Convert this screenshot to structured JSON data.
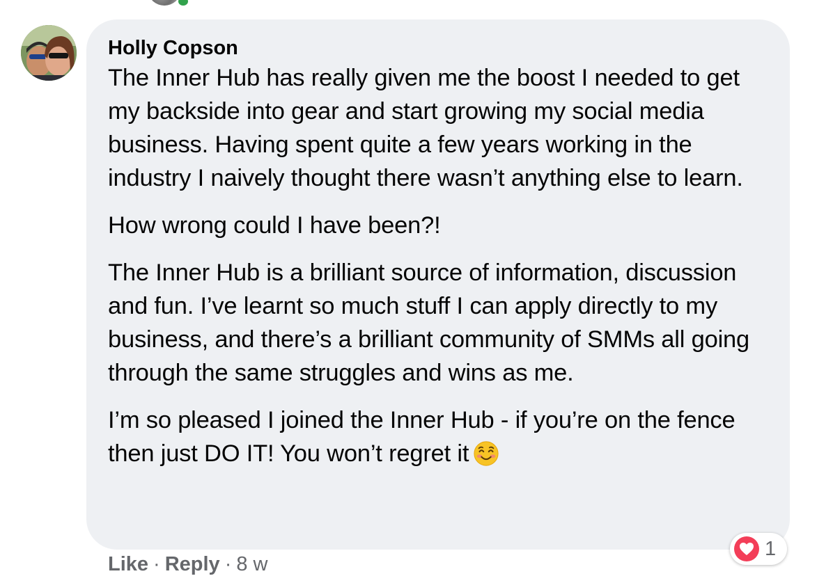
{
  "comment": {
    "author": "Holly Copson",
    "paragraphs": [
      "The Inner Hub has really given me the boost I needed to get my backside into gear and start growing my social media business. Having spent quite a few years working in the industry I naively thought there wasn’t anything else to learn.",
      "How wrong could I have been?!",
      "The Inner Hub is a brilliant source of information, discussion and fun. I’ve learnt so much stuff I can apply directly to my business, and there’s a brilliant community of SMMs all going through the same struggles and wins as me.",
      "I’m so pleased I joined the Inner Hub - if you’re on the fence then just DO IT! You won’t regret it"
    ],
    "emoji": "smiling-face-with-smiling-eyes"
  },
  "actions": {
    "like_label": "Like",
    "separator": "·",
    "reply_label": "Reply",
    "timestamp": "8 w"
  },
  "reactions": {
    "type": "love",
    "icon": "heart-icon",
    "count": "1",
    "badge_color": "#f33e58"
  },
  "colors": {
    "bubble": "#eef0f3",
    "text": "#050505",
    "secondary_text": "#65676b",
    "online": "#31a24c"
  }
}
